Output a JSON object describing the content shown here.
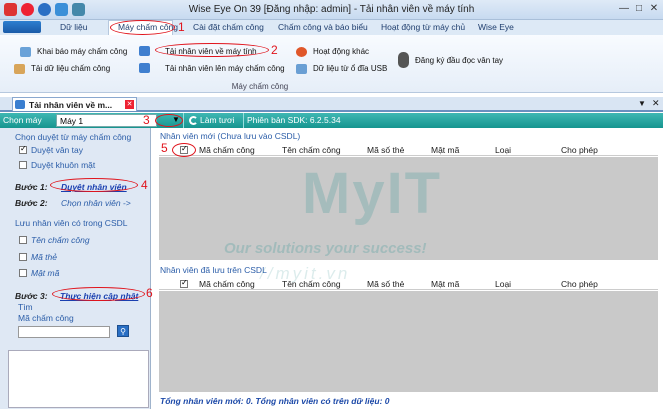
{
  "window": {
    "title": "Wise Eye On 39 [Đăng nhập: admin] - Tải nhân viên về máy tính"
  },
  "ribbon": {
    "tabs": [
      "Dữ liệu",
      "Máy chấm công",
      "Cài đặt chấm công",
      "Chấm công và báo biểu",
      "Hoạt động từ máy chủ",
      "Wise Eye"
    ],
    "buttons": {
      "khai_bao": "Khai báo máy chấm công",
      "tai_du_lieu": "Tải dữ liệu chấm công",
      "tai_nv_ve": "Tải nhân viên về máy tính",
      "tai_nv_len": "Tải nhân viên lên máy chấm công",
      "hoat_dong": "Hoạt động khác",
      "du_lieu_usb": "Dữ liệu từ ổ đĩa USB",
      "dang_ky": "Đăng ký đầu đọc vân tay"
    },
    "group_label": "Máy chấm công"
  },
  "doc_tab": {
    "label": "Tải nhân viên về m..."
  },
  "toolbar": {
    "chon_may_label": "Chọn máy",
    "machine_value": "Máy 1",
    "refresh_label": "Làm tươi",
    "sdk_label": "Phiên bản SDK: 6.2.5.34"
  },
  "left": {
    "section1": "Chọn duyệt từ máy chấm công",
    "duyet_van_tay": "Duyệt vân tay",
    "duyet_khuon_mat": "Duyệt khuôn mặt",
    "buoc1": "Bước 1:",
    "duyet_nhan_vien": "Duyệt nhân viên",
    "buoc2": "Bước 2:",
    "chon_nhan_vien": "Chọn nhân viên ->",
    "section2": "Lưu nhân viên có trong CSDL",
    "ten_cham_cong": "Tên chấm công",
    "ma_the": "Mã thẻ",
    "mat_ma": "Mật mã",
    "buoc3": "Bước 3:",
    "thuc_hien": "Thực hiện cập nhật",
    "tim": "Tìm",
    "ma_cham_cong": "Mã chấm công"
  },
  "grid_new": {
    "caption": "Nhân viên mới (Chưa lưu vào CSDL)",
    "columns": [
      "Mã chấm công",
      "Tên chấm công",
      "Mã số thẻ",
      "Mật mã",
      "Loại",
      "Cho phép"
    ]
  },
  "grid_saved": {
    "caption": "Nhân viên đã lưu trên CSDL",
    "columns": [
      "Mã chấm công",
      "Tên chấm công",
      "Mã số thẻ",
      "Mật mã",
      "Loại",
      "Cho phép"
    ]
  },
  "annotations": [
    "1",
    "2",
    "3",
    "4",
    "5",
    "6"
  ],
  "watermark": {
    "title": "MyIT",
    "subtitle": "Our solutions your success!",
    "url": "//myit.vn"
  },
  "status": "Tổng nhân viên mới: 0.  Tổng nhân viên có trên dữ liệu: 0",
  "colors": {
    "toolbar": "#16958f",
    "annotation": "#e0141c",
    "link": "#2b5da8"
  }
}
